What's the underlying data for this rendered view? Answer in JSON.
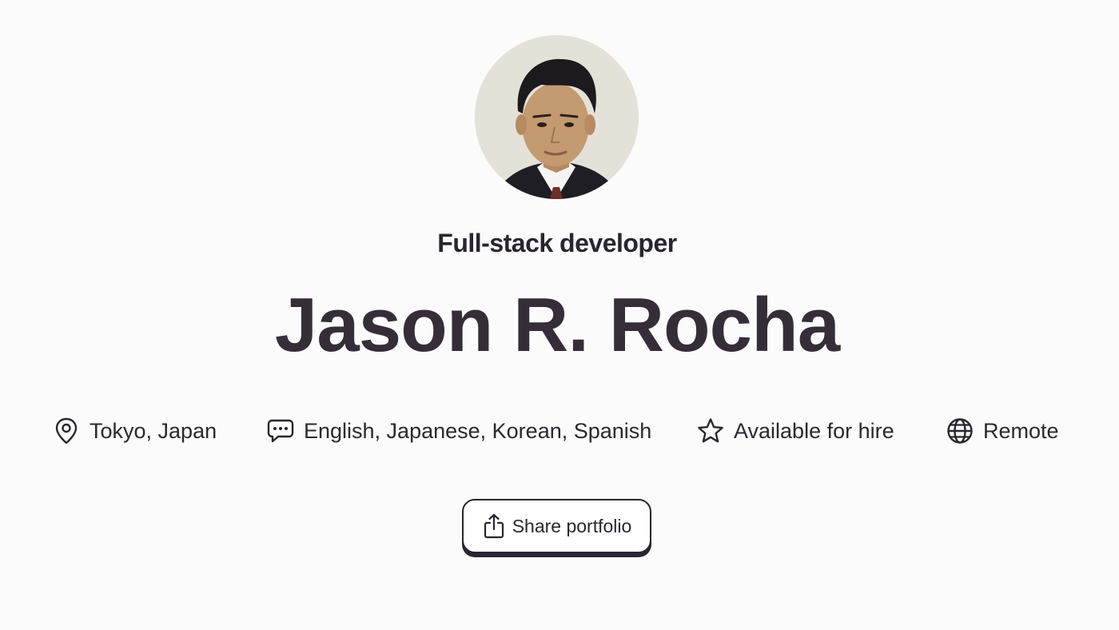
{
  "profile": {
    "avatar_alt": "Profile photo",
    "role": "Full-stack developer",
    "name": "Jason R. Rocha"
  },
  "details": [
    {
      "icon": "map-pin-icon",
      "label": "Tokyo, Japan"
    },
    {
      "icon": "chat-bubble-icon",
      "label": "English, Japanese, Korean, Spanish"
    },
    {
      "icon": "star-icon",
      "label": "Available for hire"
    },
    {
      "icon": "globe-icon",
      "label": "Remote"
    }
  ],
  "share": {
    "icon": "share-icon",
    "label": "Share portfolio"
  },
  "colors": {
    "background": "#fbfbfb",
    "text": "#2c2730",
    "button_border": "#2a2530"
  }
}
